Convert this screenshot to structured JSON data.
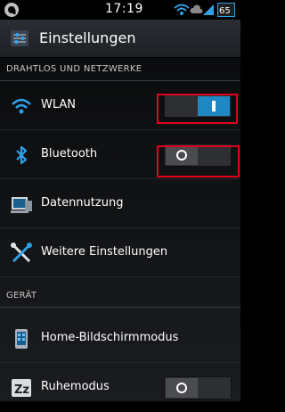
{
  "status_bar": {
    "time": "17:19",
    "battery": "65",
    "icons": [
      "circle-a-icon",
      "wifi-icon",
      "cloud-icon",
      "signal-icon",
      "battery-icon"
    ]
  },
  "action_bar": {
    "title": "Einstellungen",
    "icon": "settings-icon"
  },
  "sections": [
    {
      "header": "DRAHTLOS UND NETZWERKE",
      "items": [
        {
          "label": "WLAN",
          "icon": "wifi-icon",
          "toggle": "on"
        },
        {
          "label": "Bluetooth",
          "icon": "bluetooth-icon",
          "toggle": "off"
        },
        {
          "label": "Datennutzung",
          "icon": "data-usage-icon"
        },
        {
          "label": "Weitere Einstellungen",
          "icon": "tools-icon"
        }
      ]
    },
    {
      "header": "GERÄT",
      "items": [
        {
          "label": "Home-Bildschirmmodus",
          "icon": "home-screen-icon"
        },
        {
          "label": "Ruhemodus",
          "icon": "sleep-mode-icon",
          "toggle": "off"
        }
      ]
    }
  ],
  "colors": {
    "accent": "#1f88c4",
    "highlight": "#e0001b"
  }
}
